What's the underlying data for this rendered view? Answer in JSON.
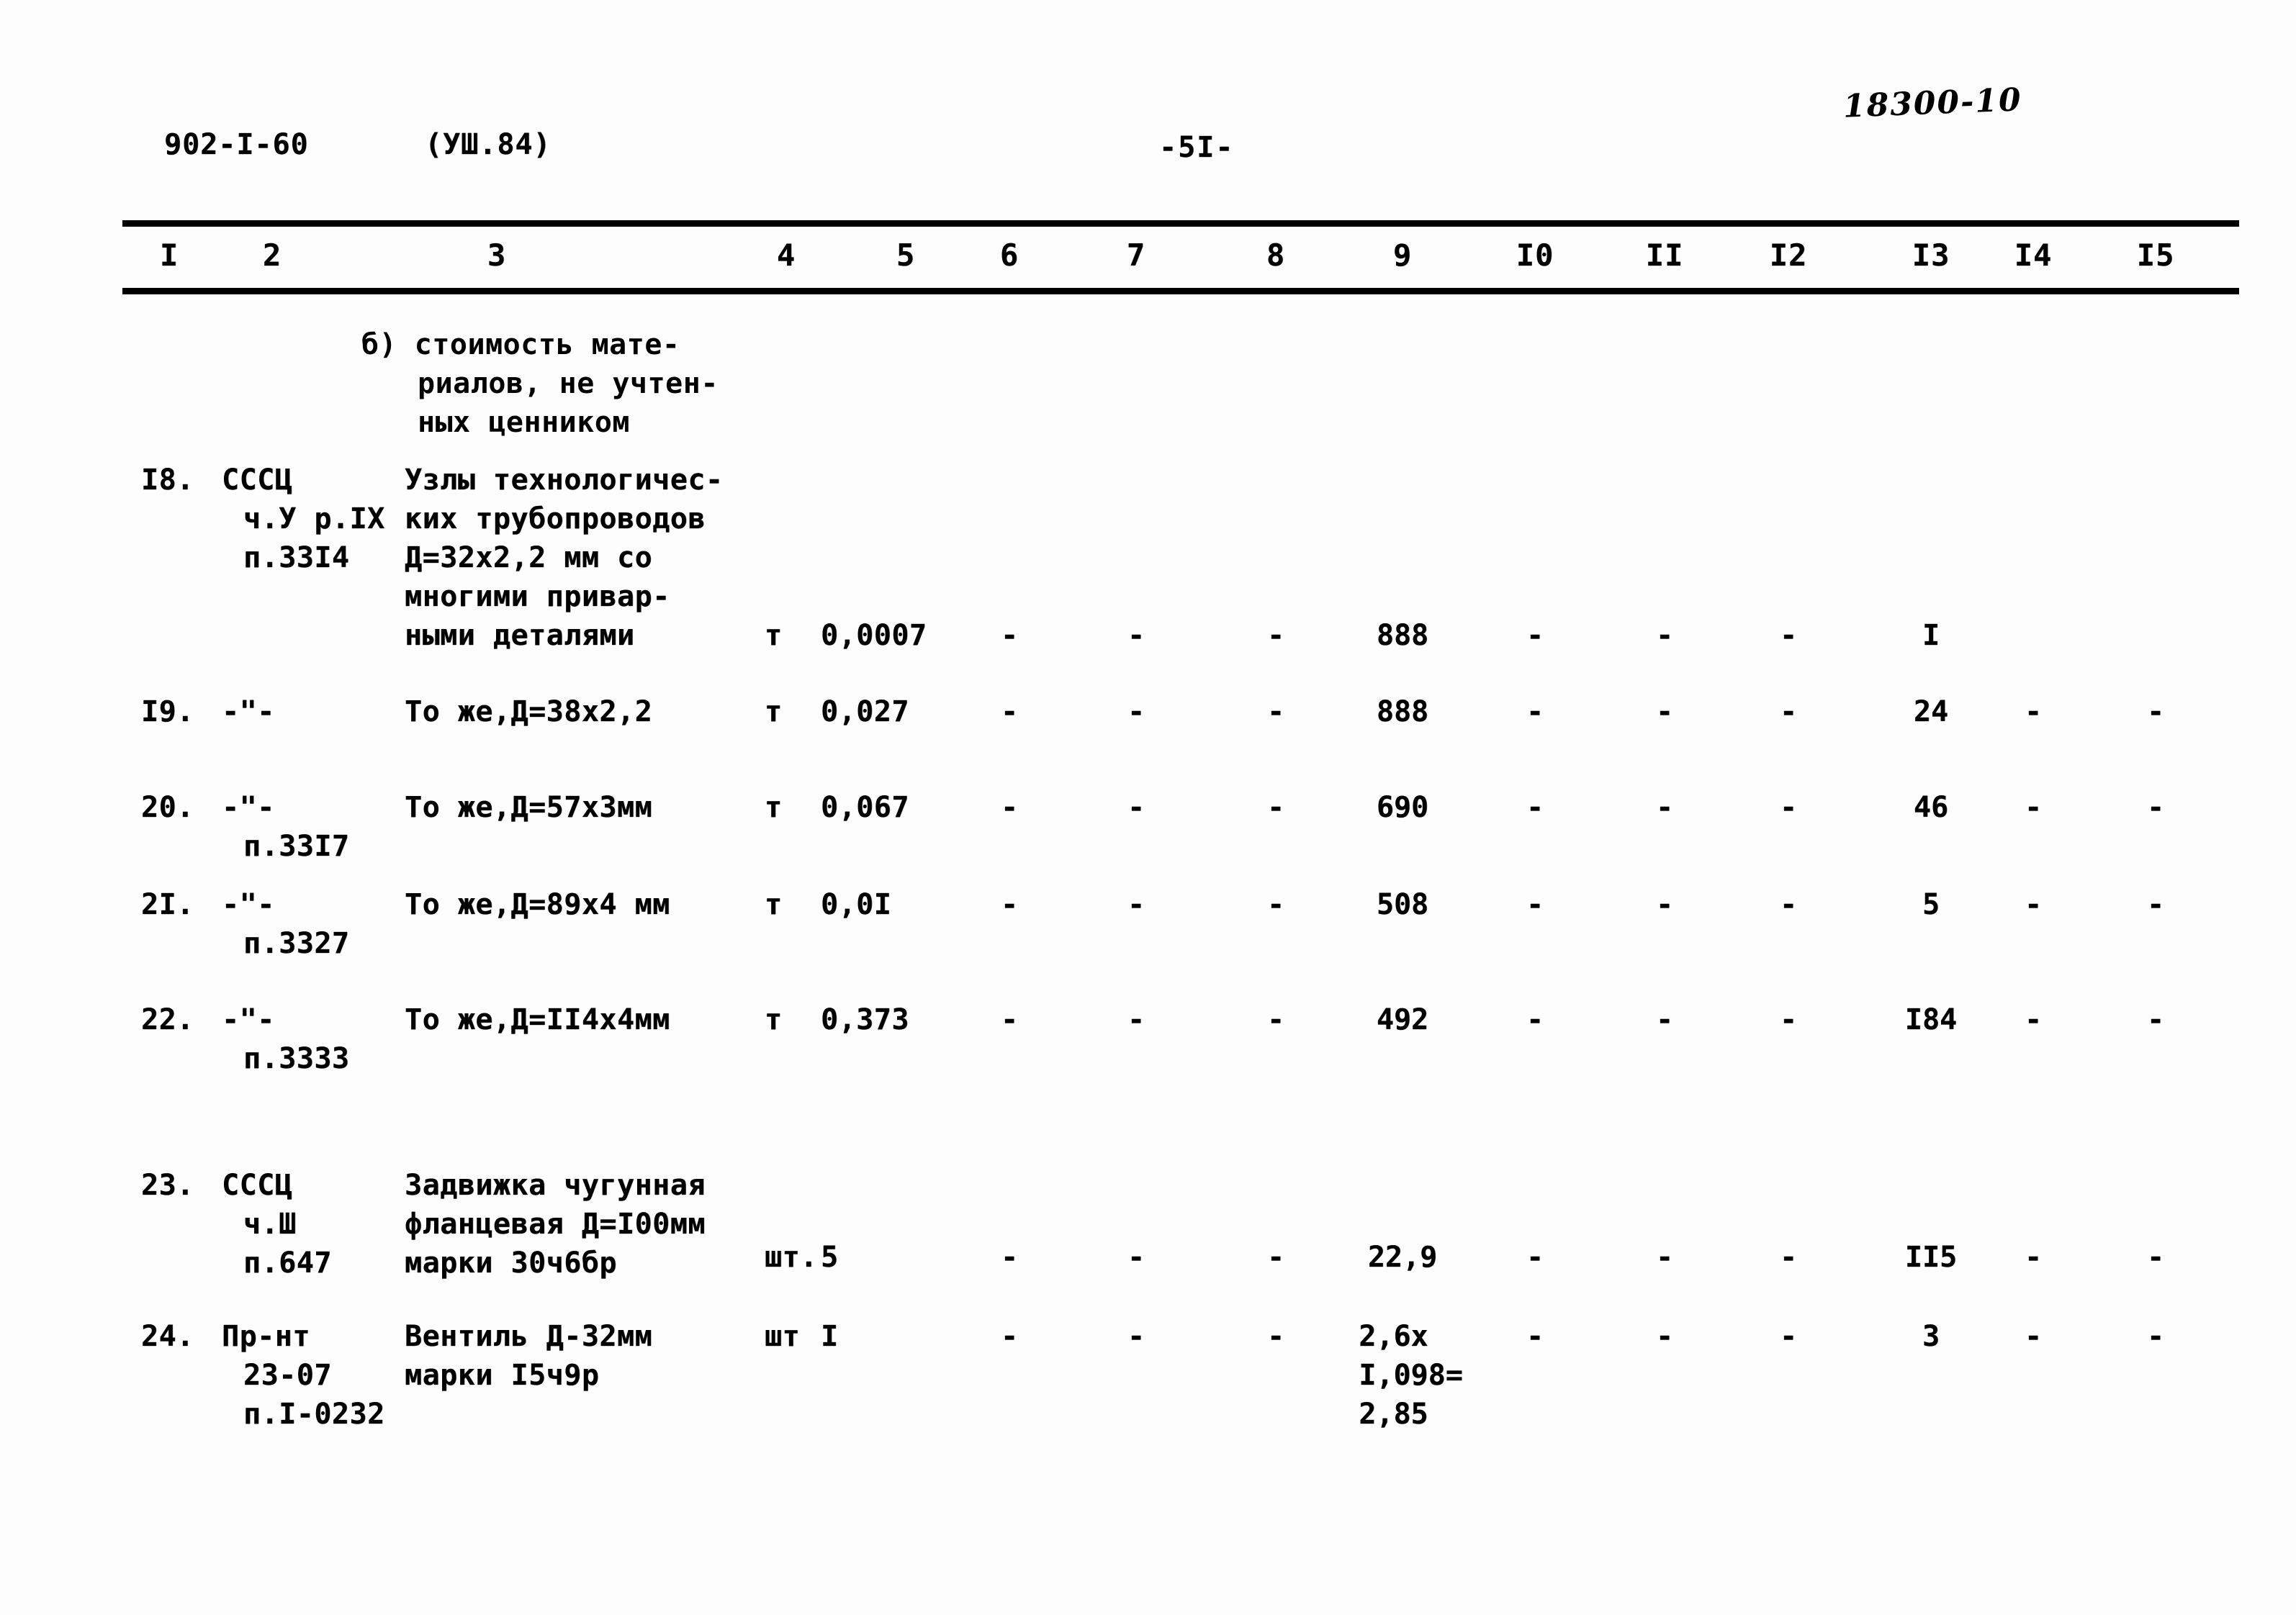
{
  "header": {
    "doc_code": "902-I-60",
    "revision": "(УШ.84)",
    "page_marker": "-5I-",
    "hand_annotation": "18300-10"
  },
  "table": {
    "column_numbers": [
      "I",
      "2",
      "3",
      "4",
      "5",
      "6",
      "7",
      "8",
      "9",
      "I0",
      "II",
      "I2",
      "I3",
      "I4",
      "I5"
    ],
    "dash": "-",
    "note": {
      "line1": "б) стоимость мате-",
      "line2": "риалов, не учтен-",
      "line3": "ных ценником"
    },
    "rows": [
      {
        "num": "I8.",
        "source_lines": [
          "СССЦ",
          "ч.У р.IX",
          "п.33I4"
        ],
        "desc_lines": [
          "Узлы технологичес-",
          "ких трубопроводов",
          "Д=32х2,2 мм со",
          "многими привар-",
          "ными деталями"
        ],
        "unit": "т",
        "qty": "0,0007",
        "c6": "-",
        "c7": "-",
        "c8": "-",
        "c9": "888",
        "c10": "-",
        "c11": "-",
        "c12": "-",
        "c13": "I",
        "c14": "",
        "c15": ""
      },
      {
        "num": "I9.",
        "source_lines": [
          "-\"-"
        ],
        "desc_lines": [
          "То же,Д=38х2,2"
        ],
        "unit": "т",
        "qty": "0,027",
        "c6": "-",
        "c7": "-",
        "c8": "-",
        "c9": "888",
        "c10": "-",
        "c11": "-",
        "c12": "-",
        "c13": "24",
        "c14": "-",
        "c15": "-"
      },
      {
        "num": "20.",
        "source_lines": [
          "-\"-",
          "п.33I7"
        ],
        "desc_lines": [
          "То же,Д=57х3мм"
        ],
        "unit": "т",
        "qty": "0,067",
        "c6": "-",
        "c7": "-",
        "c8": "-",
        "c9": "690",
        "c10": "-",
        "c11": "-",
        "c12": "-",
        "c13": "46",
        "c14": "-",
        "c15": "-"
      },
      {
        "num": "2I.",
        "source_lines": [
          "-\"-",
          "п.3327"
        ],
        "desc_lines": [
          "То же,Д=89х4 мм"
        ],
        "unit": "т",
        "qty": "0,0I",
        "c6": "-",
        "c7": "-",
        "c8": "-",
        "c9": "508",
        "c10": "-",
        "c11": "-",
        "c12": "-",
        "c13": "5",
        "c14": "-",
        "c15": "-"
      },
      {
        "num": "22.",
        "source_lines": [
          "-\"-",
          "п.3333"
        ],
        "desc_lines": [
          "То же,Д=II4х4мм"
        ],
        "unit": "т",
        "qty": "0,373",
        "c6": "-",
        "c7": "-",
        "c8": "-",
        "c9": "492",
        "c10": "-",
        "c11": "-",
        "c12": "-",
        "c13": "I84",
        "c14": "-",
        "c15": "-"
      },
      {
        "num": "23.",
        "source_lines": [
          "СССЦ",
          "ч.Ш",
          "п.647"
        ],
        "desc_lines": [
          "Задвижка чугунная",
          "фланцевая Д=I00мм",
          "марки 30ч6бр"
        ],
        "unit": "шт.",
        "qty": "5",
        "c6": "-",
        "c7": "-",
        "c8": "-",
        "c9": "22,9",
        "c10": "-",
        "c11": "-",
        "c12": "-",
        "c13": "II5",
        "c14": "-",
        "c15": "-"
      },
      {
        "num": "24.",
        "source_lines": [
          "Пр-нт",
          "23-07",
          "п.I-0232"
        ],
        "desc_lines": [
          "Вентиль Д-32мм",
          "марки I5ч9р"
        ],
        "unit": "шт",
        "qty": "I",
        "c6": "-",
        "c7": "-",
        "c8": "-",
        "c9": "2,6х\nI,098=\n2,85",
        "c10": "-",
        "c11": "-",
        "c12": "-",
        "c13": "3",
        "c14": "-",
        "c15": "-"
      }
    ]
  }
}
